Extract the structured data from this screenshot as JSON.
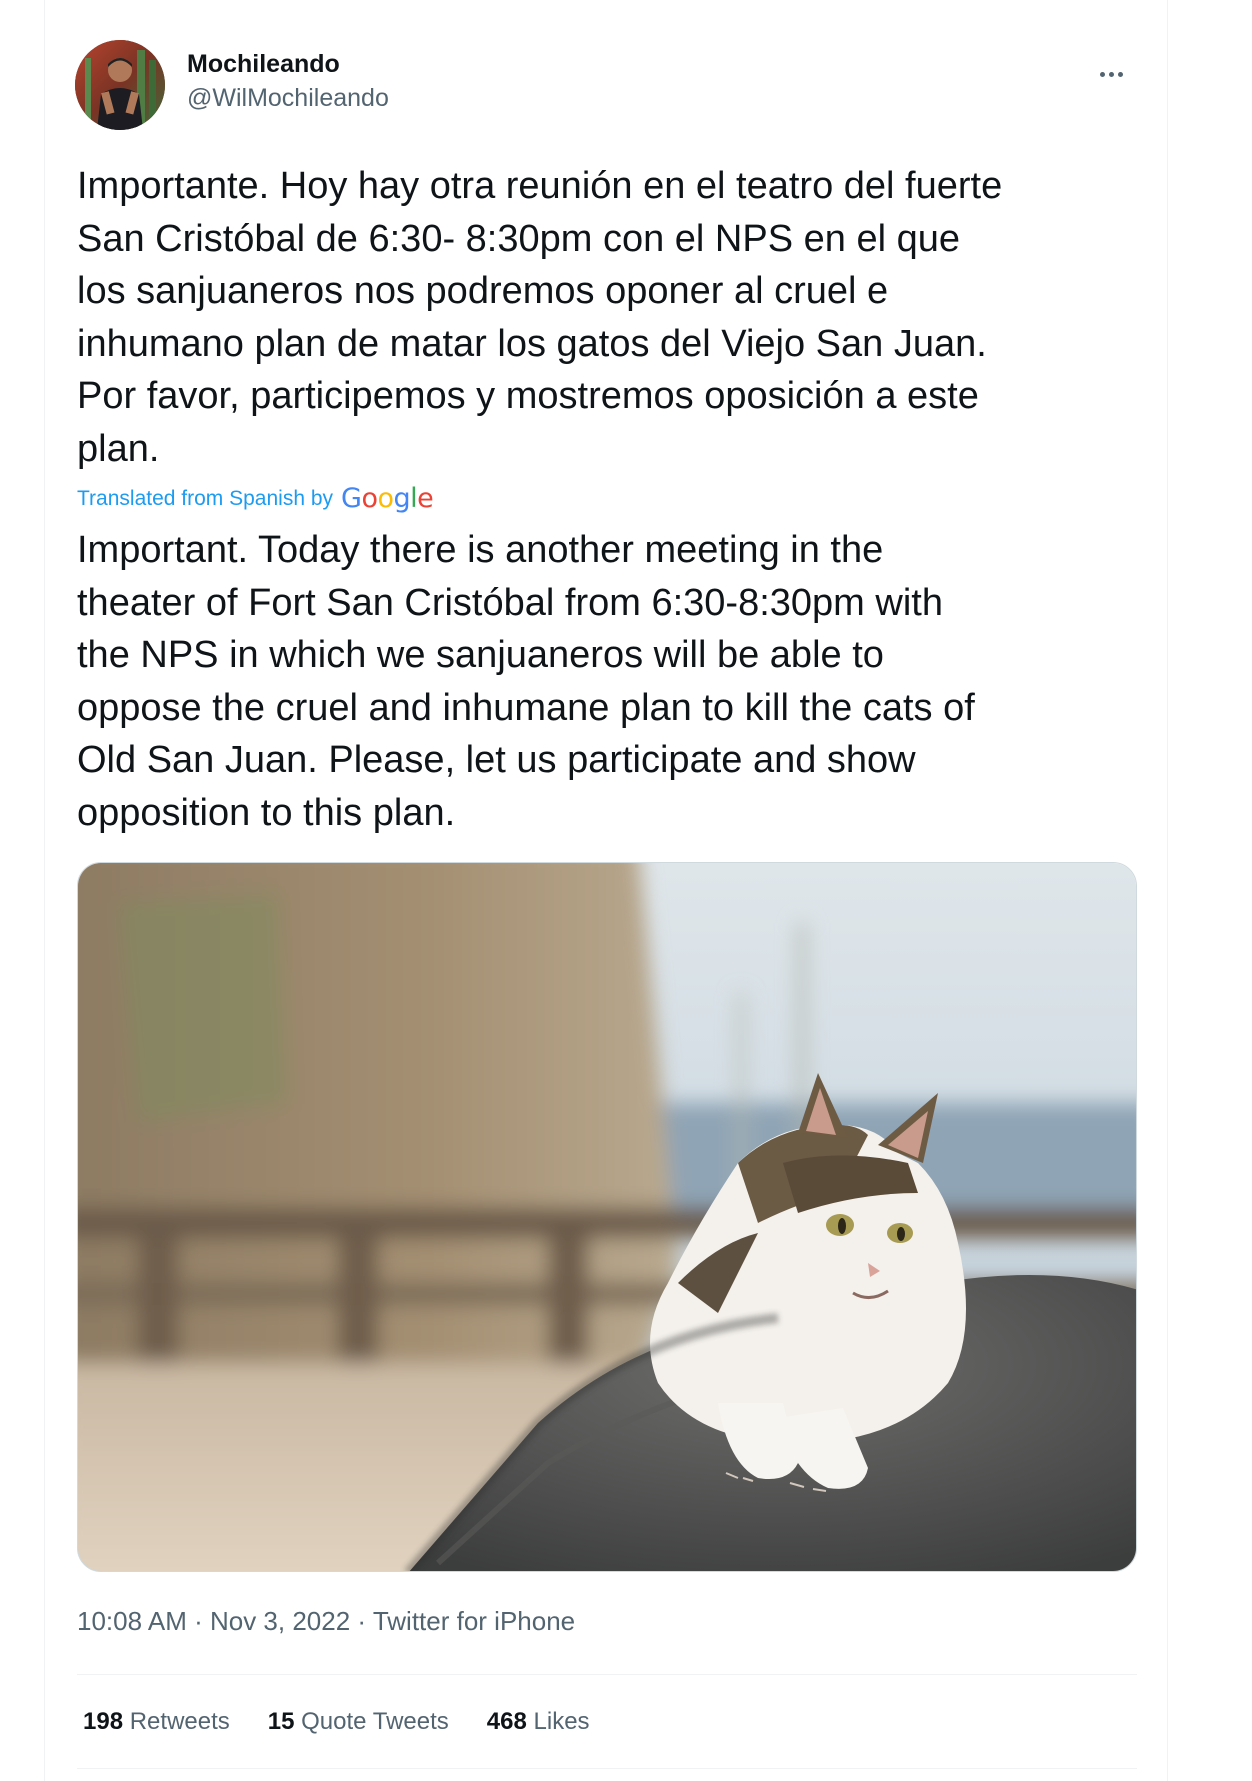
{
  "author": {
    "display_name": "Mochileando",
    "handle": "@WilMochileando",
    "avatar_icon": "profile-photo"
  },
  "more_menu": {
    "icon": "more-horizontal-icon"
  },
  "tweet": {
    "text": "Importante. Hoy hay otra reunión en el teatro del fuerte\nSan Cristóbal de 6:30- 8:30pm con el NPS en el que\nlos sanjuaneros nos podremos oponer al cruel e\ninhumano plan de matar los gatos del Viejo San Juan.\nPor favor, participemos y mostremos oposición a este\nplan.",
    "translated_label": "Translated from Spanish by",
    "translator_logo": {
      "letters": [
        "G",
        "o",
        "o",
        "g",
        "l",
        "e"
      ],
      "colors": [
        "#4285f4",
        "#ea4335",
        "#fbbc05",
        "#4285f4",
        "#34a853",
        "#ea4335"
      ]
    },
    "translation": "Important. Today there is another meeting in the\ntheater of Fort San Cristóbal from 6:30-8:30pm with\nthe NPS in which we sanjuaneros will be able to\noppose the cruel and inhumane plan to kill the cats of\nOld San Juan. Please, let us participate and show\nopposition to this plan."
  },
  "meta": {
    "time": "10:08 AM",
    "separator": " · ",
    "date": "Nov 3, 2022",
    "source": "Twitter for iPhone"
  },
  "stats": [
    {
      "count": "198",
      "label": "Retweets"
    },
    {
      "count": "15",
      "label": "Quote Tweets"
    },
    {
      "count": "468",
      "label": "Likes"
    }
  ],
  "colors": {
    "text_primary": "#0f1419",
    "text_secondary": "#536471",
    "link_blue": "#1d9bf0",
    "divider": "#eff3f4"
  }
}
